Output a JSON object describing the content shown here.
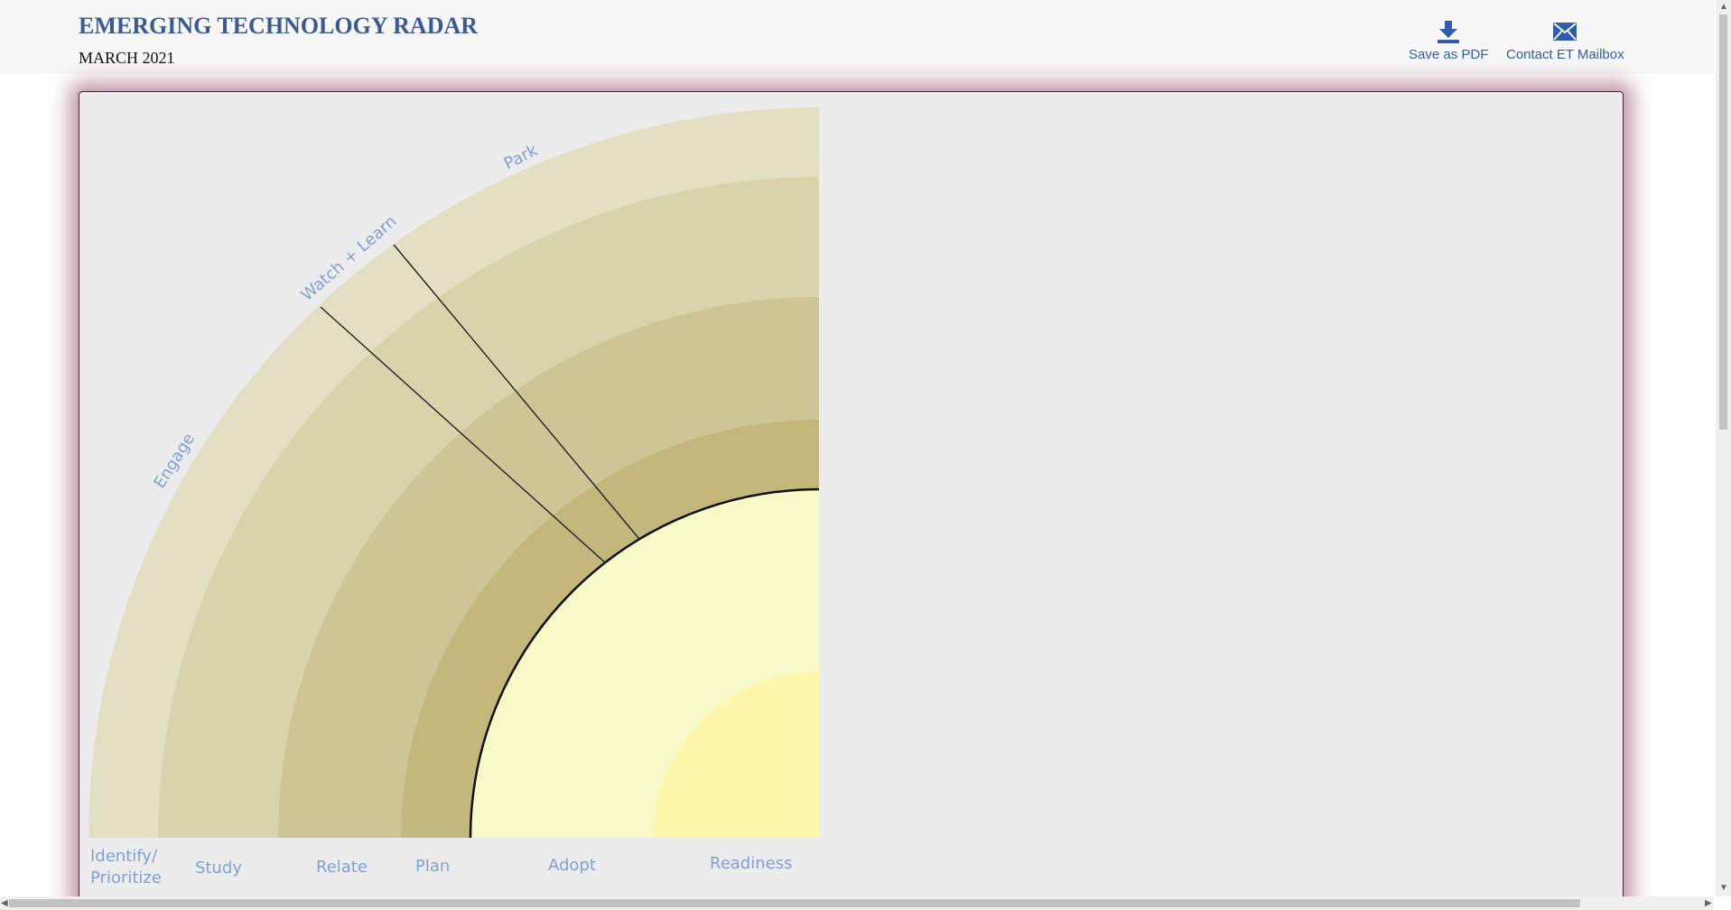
{
  "header": {
    "title": "EMERGING TECHNOLOGY RADAR",
    "date": "MARCH 2021",
    "save_pdf_label": "Save as PDF",
    "contact_label": "Contact ET Mailbox",
    "save_icon": "download-icon",
    "contact_icon": "envelope-icon",
    "accent_color": "#2f5dab",
    "title_color": "#3a5a93"
  },
  "radar": {
    "rings": [
      "Identify/ Prioritize",
      "Study",
      "Relate",
      "Plan",
      "Adopt",
      "Readiness"
    ],
    "ring_label_line1": "Identify/",
    "ring_label_line2": "Prioritize",
    "sectors": [
      "Engage",
      "Watch + Learn",
      "Park"
    ],
    "ring_colors": [
      "#e3dfc3",
      "#d9d3ac",
      "#cdc595",
      "#c3b77c",
      "#f8f9c8",
      "#fcf7aa"
    ],
    "label_color": "#7fa1d6"
  }
}
